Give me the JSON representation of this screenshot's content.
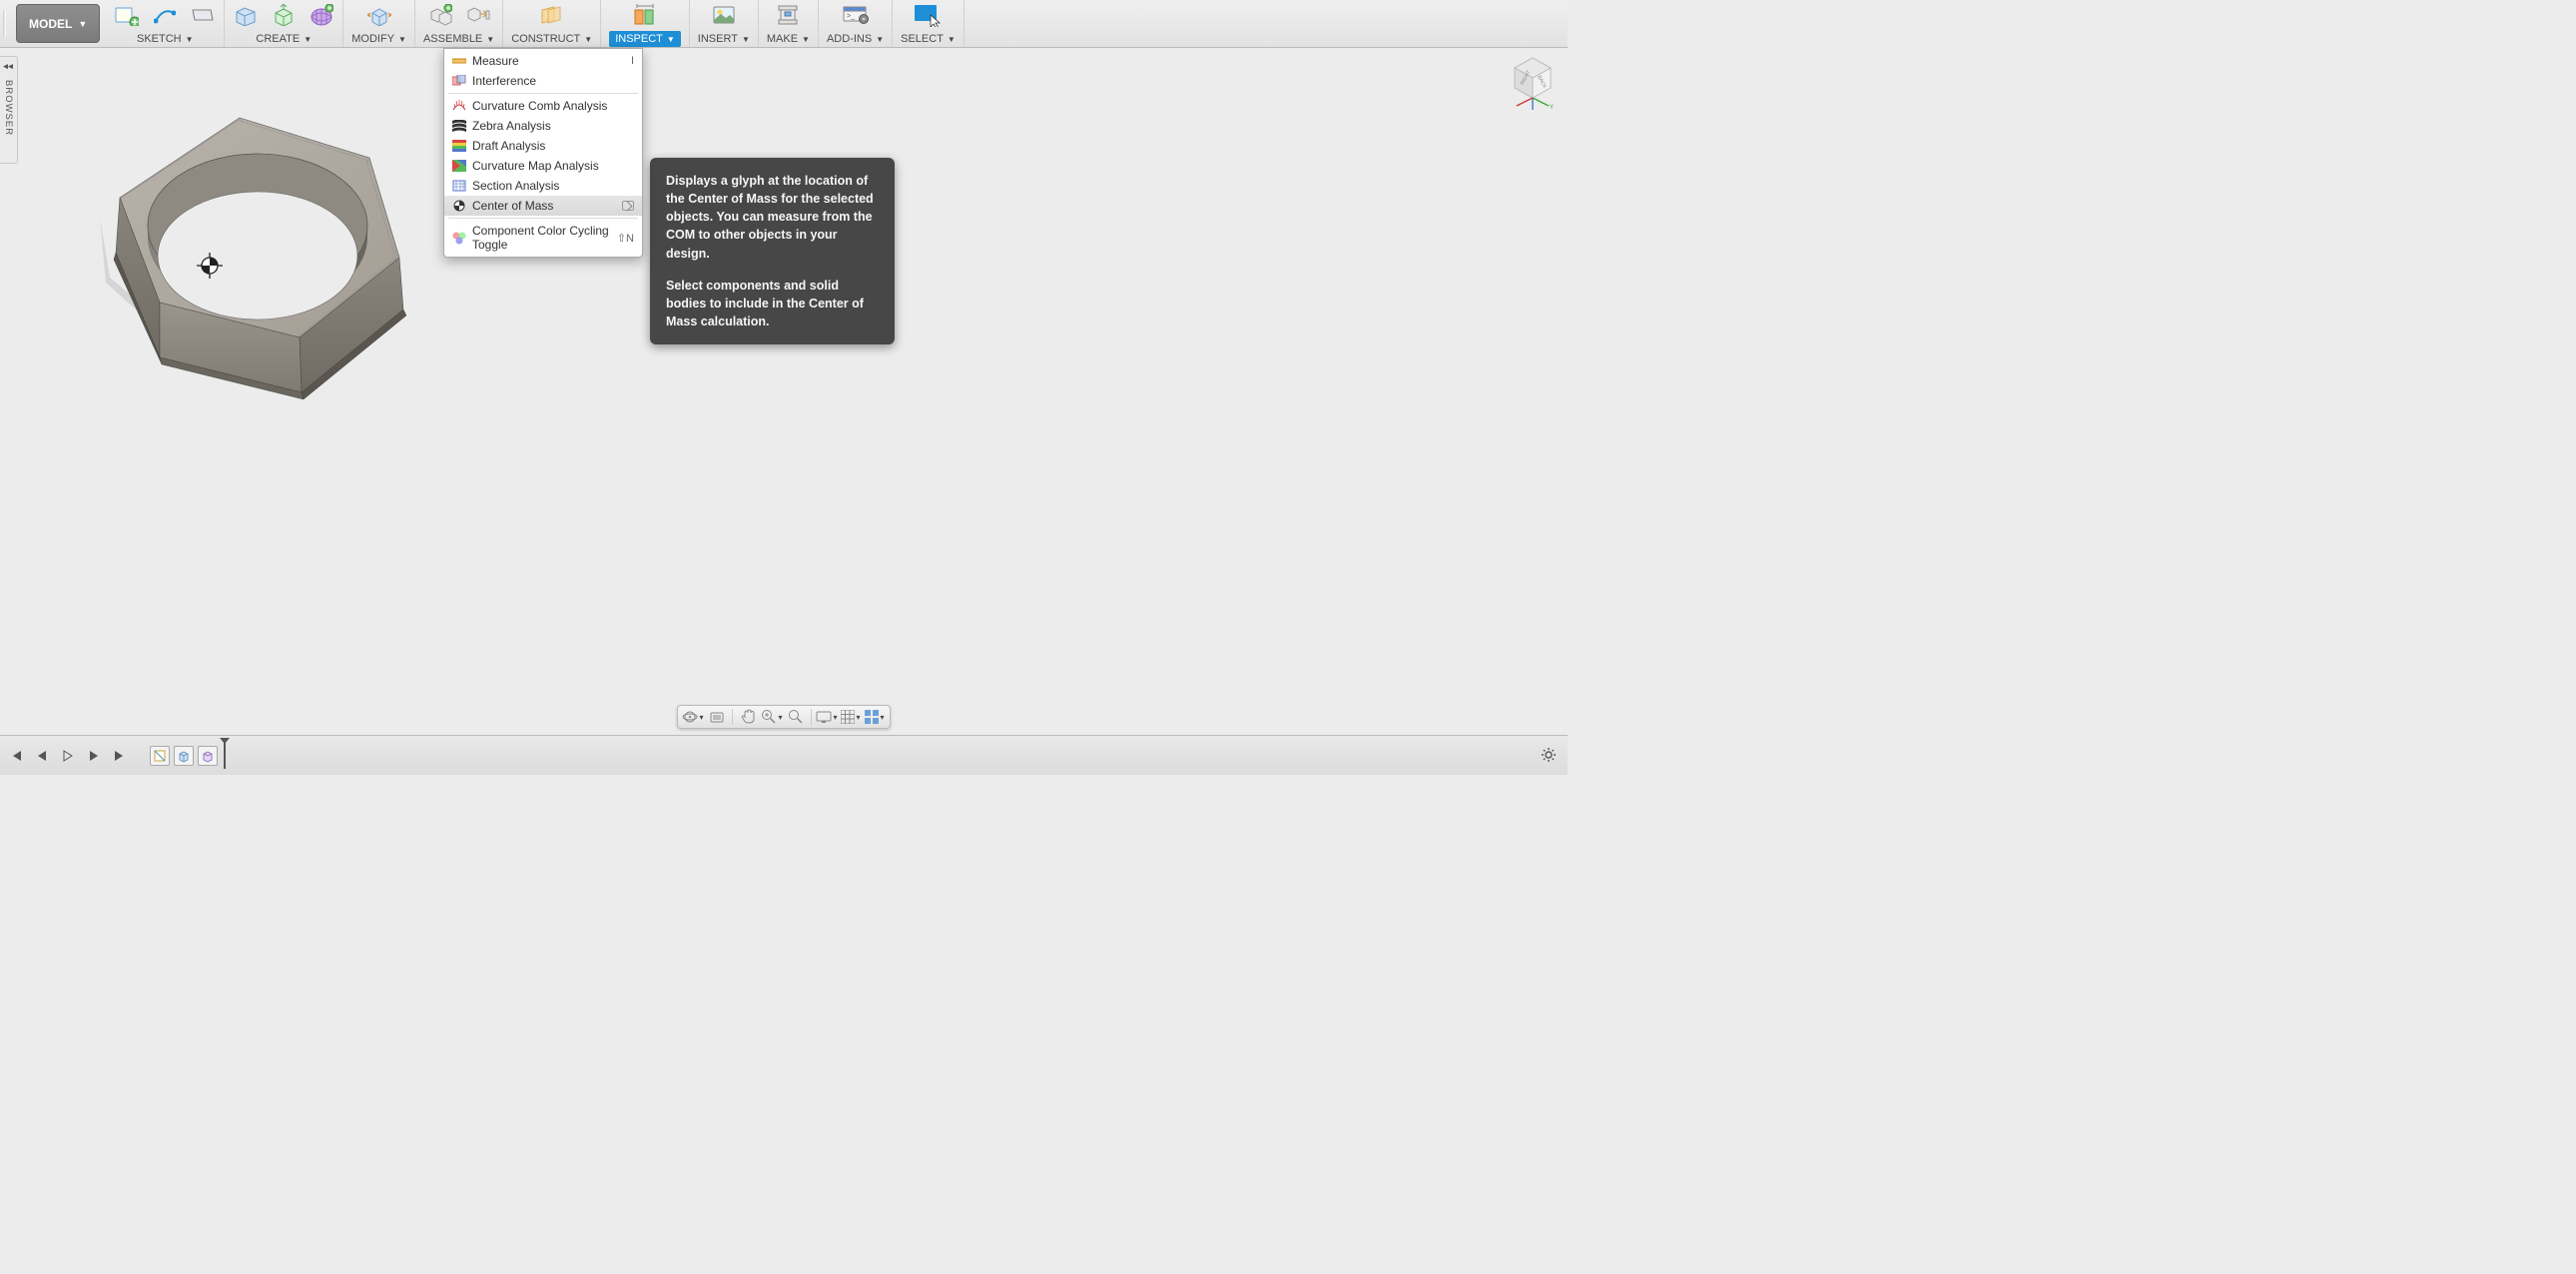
{
  "mode_button": "MODEL",
  "toolbar_groups": [
    {
      "key": "sketch",
      "label": "SKETCH"
    },
    {
      "key": "create",
      "label": "CREATE"
    },
    {
      "key": "modify",
      "label": "MODIFY"
    },
    {
      "key": "assemble",
      "label": "ASSEMBLE"
    },
    {
      "key": "construct",
      "label": "CONSTRUCT"
    },
    {
      "key": "inspect",
      "label": "INSPECT"
    },
    {
      "key": "insert",
      "label": "INSERT"
    },
    {
      "key": "make",
      "label": "MAKE"
    },
    {
      "key": "addins",
      "label": "ADD-INS"
    },
    {
      "key": "select",
      "label": "SELECT"
    }
  ],
  "browser_label": "BROWSER",
  "inspect_menu": [
    {
      "key": "measure",
      "label": "Measure",
      "shortcut": "I"
    },
    {
      "key": "interference",
      "label": "Interference"
    },
    {
      "key": "sep"
    },
    {
      "key": "curvature-comb",
      "label": "Curvature Comb Analysis"
    },
    {
      "key": "zebra",
      "label": "Zebra Analysis"
    },
    {
      "key": "draft",
      "label": "Draft Analysis"
    },
    {
      "key": "curvature-map",
      "label": "Curvature Map Analysis"
    },
    {
      "key": "section",
      "label": "Section Analysis"
    },
    {
      "key": "center-of-mass",
      "label": "Center of Mass",
      "hover": true,
      "flag": true
    },
    {
      "key": "sep"
    },
    {
      "key": "color-cycling",
      "label": "Component Color Cycling Toggle",
      "shortcut": "⇧N"
    }
  ],
  "tooltip": {
    "p1": "Displays a glyph at the location of the Center of Mass for the selected objects. You can measure from the COM to other objects in your design.",
    "p2": "Select components and solid bodies to include in the Center of Mass calculation."
  },
  "viewcube": {
    "face_right": "RIGHT",
    "face_back": "BACK"
  }
}
